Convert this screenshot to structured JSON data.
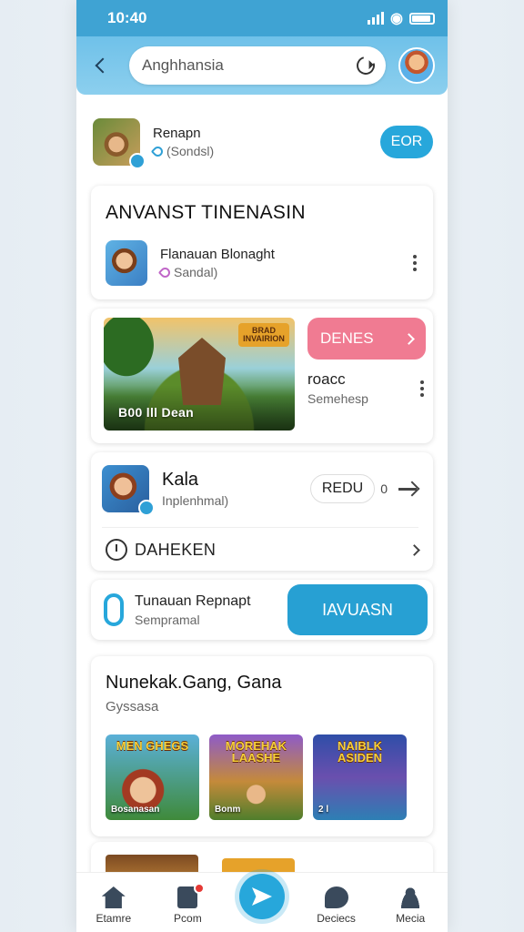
{
  "status_bar": {
    "time": "10:40"
  },
  "header": {
    "search_value": "Anghhansia"
  },
  "row1": {
    "title": "Renapn",
    "subtitle": "(Sondsl)",
    "button": "EOR"
  },
  "announce": {
    "heading": "ANVANST TINENASIN",
    "item_title": "Flanauan Blonaght",
    "item_subtitle": "Sandal)"
  },
  "feature": {
    "banner_logo": "BRAD INVAIRION",
    "banner_label": "B00 lll Dean",
    "button": "DENES",
    "info_title": "roacc",
    "info_subtitle": "Semehesp"
  },
  "kala": {
    "title": "Kala",
    "subtitle": "Inplenhmal)",
    "pill": "REDU",
    "extra": "0",
    "bottom_label": "DAHEKEN"
  },
  "tunauan": {
    "title": "Tunauan Repnapt",
    "subtitle": "Sempramal",
    "button": "IAVUASN"
  },
  "games": {
    "title": "Nunekak.Gang, Gana",
    "subtitle": "Gyssasa",
    "tiles": [
      {
        "logo": "MEN GHEGS",
        "label": "Bosanasan"
      },
      {
        "logo": "MOREHAK LAASHE",
        "label": "Bonm"
      },
      {
        "logo": "NAIBLK ASIDEN",
        "label": "2 l"
      }
    ]
  },
  "bottom_nav": [
    {
      "label": "Etamre",
      "icon": "home-icon"
    },
    {
      "label": "Pcom",
      "icon": "document-icon"
    },
    {
      "label": "",
      "icon": "send-icon"
    },
    {
      "label": "Deciecs",
      "icon": "chat-icon"
    },
    {
      "label": "Meciа",
      "icon": "person-icon"
    }
  ],
  "colors": {
    "accent": "#27a7db",
    "pink": "#f07b92",
    "header": "#6fc1e9"
  }
}
